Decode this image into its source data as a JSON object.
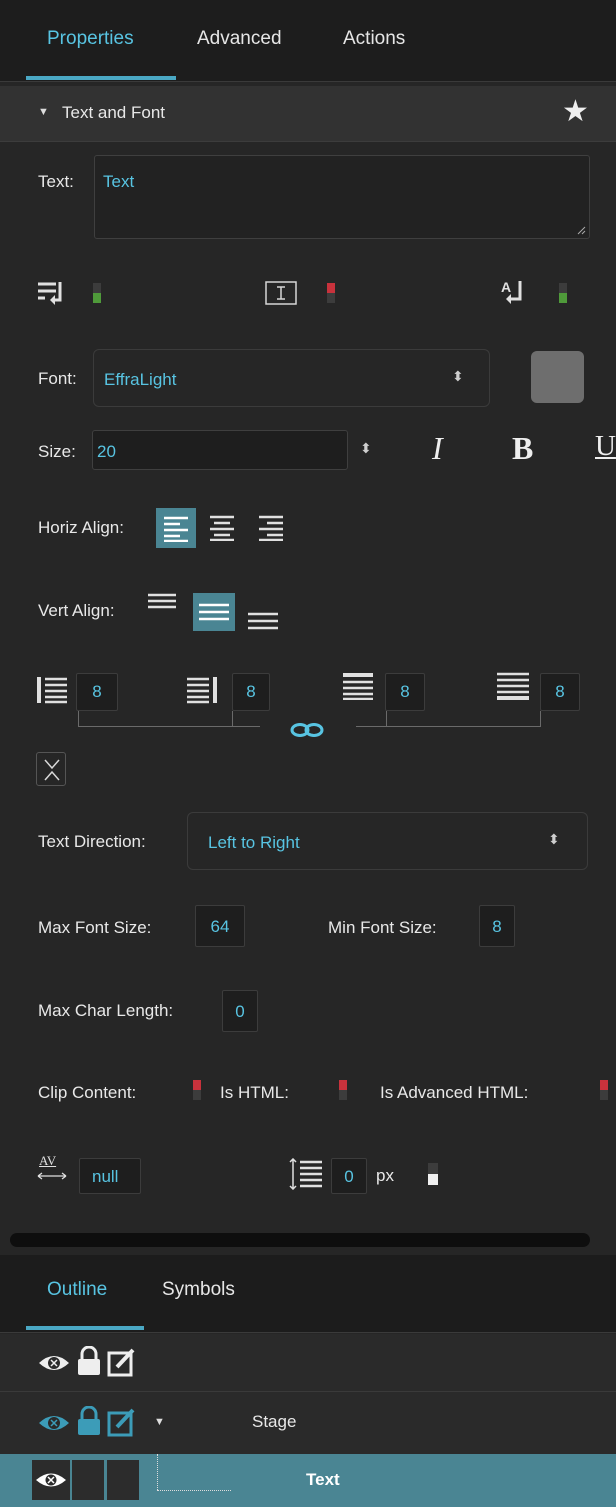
{
  "tabs": {
    "properties": "Properties",
    "advanced": "Advanced",
    "actions": "Actions"
  },
  "section": {
    "title": "Text and Font"
  },
  "text_field": {
    "label": "Text:",
    "value": "Text"
  },
  "toggles_row": [
    {
      "icon": "word-wrap-icon",
      "state": "green"
    },
    {
      "icon": "text-box-icon",
      "state": "red"
    },
    {
      "icon": "text-return-icon",
      "state": "green"
    }
  ],
  "font": {
    "label": "Font:",
    "value": "EffraLight",
    "swatch_color": "#6e6e6e"
  },
  "size": {
    "label": "Size:",
    "value": "20",
    "italic": "I",
    "bold": "B",
    "underline": "U"
  },
  "horiz_align": {
    "label": "Horiz Align:",
    "selected": "left"
  },
  "vert_align": {
    "label": "Vert Align:",
    "selected": "middle"
  },
  "padding": {
    "left": "8",
    "right": "8",
    "top": "8",
    "bottom": "8"
  },
  "text_direction": {
    "label": "Text Direction:",
    "value": "Left to Right"
  },
  "max_font_size": {
    "label": "Max Font Size:",
    "value": "64"
  },
  "min_font_size": {
    "label": "Min Font Size:",
    "value": "8"
  },
  "max_char_length": {
    "label": "Max Char Length:",
    "value": "0"
  },
  "flags": {
    "clip_content": "Clip Content:",
    "is_html": "Is HTML:",
    "is_advanced_html": "Is Advanced HTML:"
  },
  "spacing": {
    "letter_spacing_icon": "AV",
    "letter_spacing": "null",
    "line_spacing": "0",
    "unit": "px"
  },
  "bottom_tabs": {
    "outline": "Outline",
    "symbols": "Symbols"
  },
  "outline_rows": [
    {
      "label": "Stage"
    },
    {
      "label": "Text"
    }
  ],
  "colors": {
    "accent": "#58c4e2",
    "selected_row": "#4a8593",
    "toggle_on": "#4f9a3a",
    "toggle_off": "#c8323c"
  }
}
